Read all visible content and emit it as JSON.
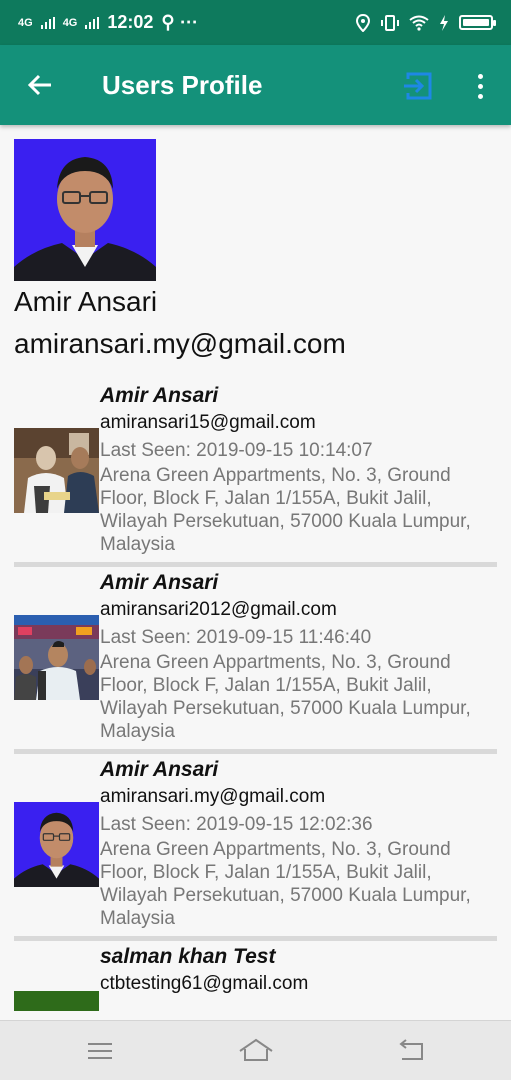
{
  "status_bar": {
    "network_1": "4G",
    "network_2": "4G",
    "time": "12:02",
    "extra": "⚲ ⋯"
  },
  "app_bar": {
    "title": "Users Profile",
    "icons": {
      "back": "arrow-left-icon",
      "logout": "logout-icon",
      "more": "more-vert-icon"
    },
    "logout_color": "#1e88e5"
  },
  "profile": {
    "name": "Amir Ansari",
    "email": "amiransari.my@gmail.com"
  },
  "users": [
    {
      "name": "Amir Ansari",
      "email": "amiransari15@gmail.com",
      "last_seen": "Last Seen: 2019-09-15 10:14:07",
      "address": "Arena Green Appartments, No. 3, Ground Floor, Block F, Jalan 1/155A, Bukit Jalil, Wilayah Persekutuan, 57000 Kuala Lumpur, Malaysia"
    },
    {
      "name": "Amir Ansari",
      "email": "amiransari2012@gmail.com",
      "last_seen": "Last Seen: 2019-09-15 11:46:40",
      "address": "Arena Green Appartments, No. 3, Ground Floor, Block F, Jalan 1/155A, Bukit Jalil, Wilayah Persekutuan, 57000 Kuala Lumpur, Malaysia"
    },
    {
      "name": "Amir Ansari",
      "email": "amiransari.my@gmail.com",
      "last_seen": "Last Seen: 2019-09-15 12:02:36",
      "address": "Arena Green Appartments, No. 3, Ground Floor, Block F, Jalan 1/155A, Bukit Jalil, Wilayah Persekutuan, 57000 Kuala Lumpur, Malaysia"
    },
    {
      "name": "salman khan Test",
      "email": "ctbtesting61@gmail.com",
      "last_seen": "",
      "address": ""
    }
  ],
  "colors": {
    "status_bar": "#0e7a5d",
    "app_bar": "#14917a",
    "avatar_bg": "#3a20f0",
    "divider": "#d9d9d9"
  }
}
